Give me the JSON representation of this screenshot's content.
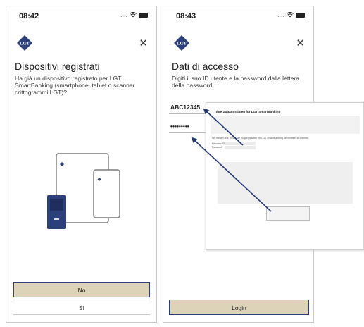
{
  "colors": {
    "navy": "#2b3f7a",
    "beige": "#ddd3b9",
    "arrow": "#22387a"
  },
  "left_screen": {
    "time": "08:42",
    "signal": "....",
    "logo_icon": "lgt-logo",
    "logo_text": "LGT",
    "close_icon": "close-icon",
    "title": "Dispositivi registrati",
    "description": "Ha già un dispositivo registrato per LGT SmartBanking (smartphone, tablet o scanner crittogrammi LGT)?",
    "illustration": "devices-illustration",
    "primary_button": "No",
    "secondary_button": "Sì"
  },
  "right_screen": {
    "time": "08:43",
    "signal": "....",
    "logo_icon": "lgt-logo",
    "logo_text": "LGT",
    "close_icon": "close-icon",
    "title": "Dati di accesso",
    "description": "Digiti il suo ID utente e la password dalla lettera della password.",
    "user_id_value": "ABC12345",
    "password_value": "•••••••••",
    "login_button": "Login"
  },
  "popup": {
    "title": "Ihre Zugangsdaten für LGT SmartBanking",
    "text": "Wir freuen uns, Ihnen die Zugangsdaten für LGT SmartBanking übermitteln zu können.",
    "label_user": "Benutzer-ID",
    "label_password": "Passwort"
  }
}
